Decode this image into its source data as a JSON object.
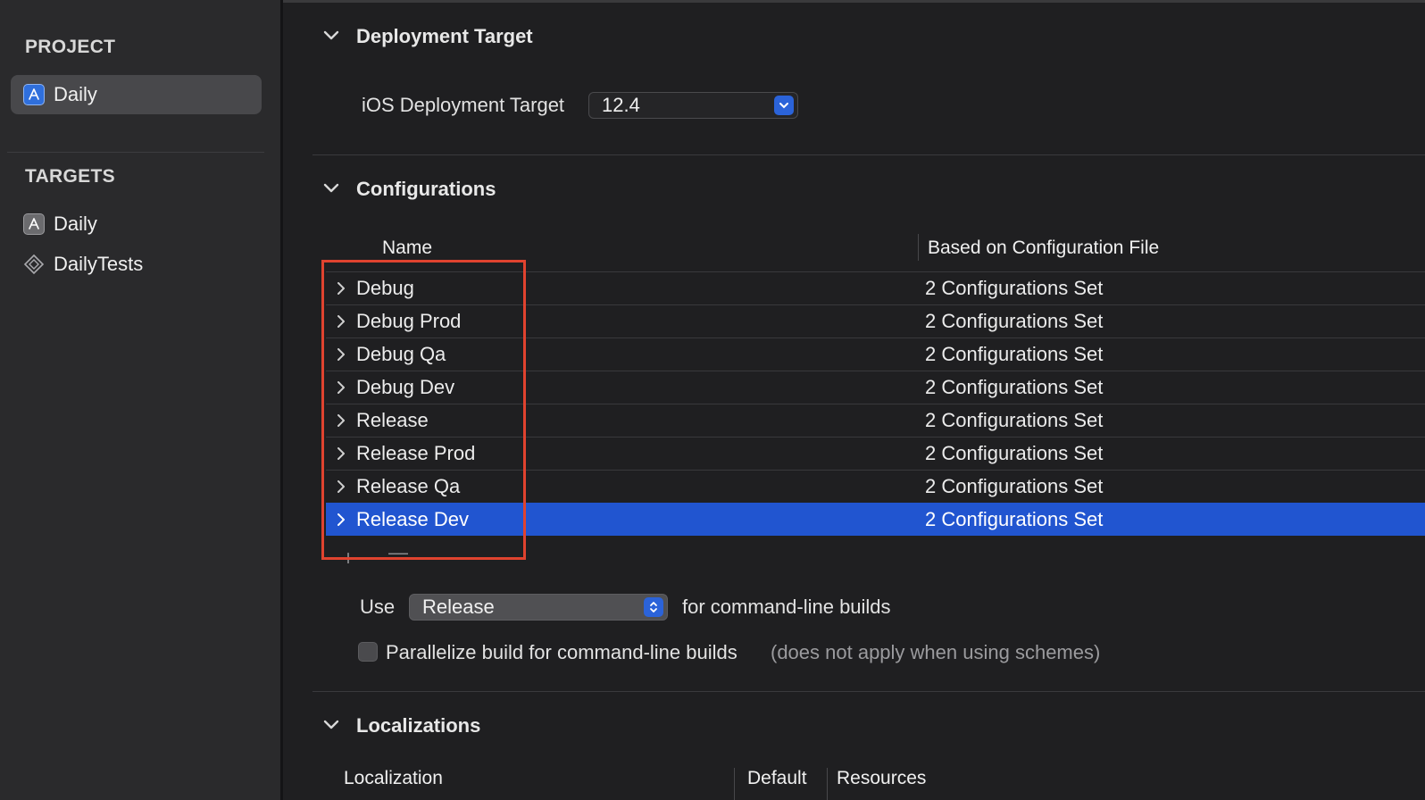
{
  "sidebar": {
    "project_header": "PROJECT",
    "project_items": [
      {
        "label": "Daily",
        "icon": "app-icon",
        "selected": true
      }
    ],
    "targets_header": "TARGETS",
    "target_items": [
      {
        "label": "Daily",
        "icon": "app-icon"
      },
      {
        "label": "DailyTests",
        "icon": "tests-icon"
      }
    ]
  },
  "deployment": {
    "title": "Deployment Target",
    "ios_label": "iOS Deployment Target",
    "ios_value": "12.4"
  },
  "configurations": {
    "title": "Configurations",
    "columns": {
      "name": "Name",
      "based_on": "Based on Configuration File"
    },
    "rows": [
      {
        "name": "Debug",
        "based_on": "2 Configurations Set"
      },
      {
        "name": "Debug Prod",
        "based_on": "2 Configurations Set"
      },
      {
        "name": "Debug Qa",
        "based_on": "2 Configurations Set"
      },
      {
        "name": "Debug Dev",
        "based_on": "2 Configurations Set"
      },
      {
        "name": "Release",
        "based_on": "2 Configurations Set"
      },
      {
        "name": "Release Prod",
        "based_on": "2 Configurations Set"
      },
      {
        "name": "Release Qa",
        "based_on": "2 Configurations Set"
      },
      {
        "name": "Release Dev",
        "based_on": "2 Configurations Set",
        "selected": true
      }
    ],
    "add_label": "+",
    "remove_label": "—",
    "use_label": "Use",
    "use_value": "Release",
    "use_suffix": "for command-line builds",
    "parallelize_label": "Parallelize build for command-line builds",
    "parallelize_note": "(does not apply when using schemes)",
    "parallelize_checked": false
  },
  "localizations": {
    "title": "Localizations",
    "columns": {
      "localization": "Localization",
      "default": "Default",
      "resources": "Resources"
    }
  },
  "colors": {
    "accent": "#2155d0",
    "highlight_box": "#e0432f",
    "background": "#1f1f21",
    "sidebar": "#2a2a2c"
  }
}
